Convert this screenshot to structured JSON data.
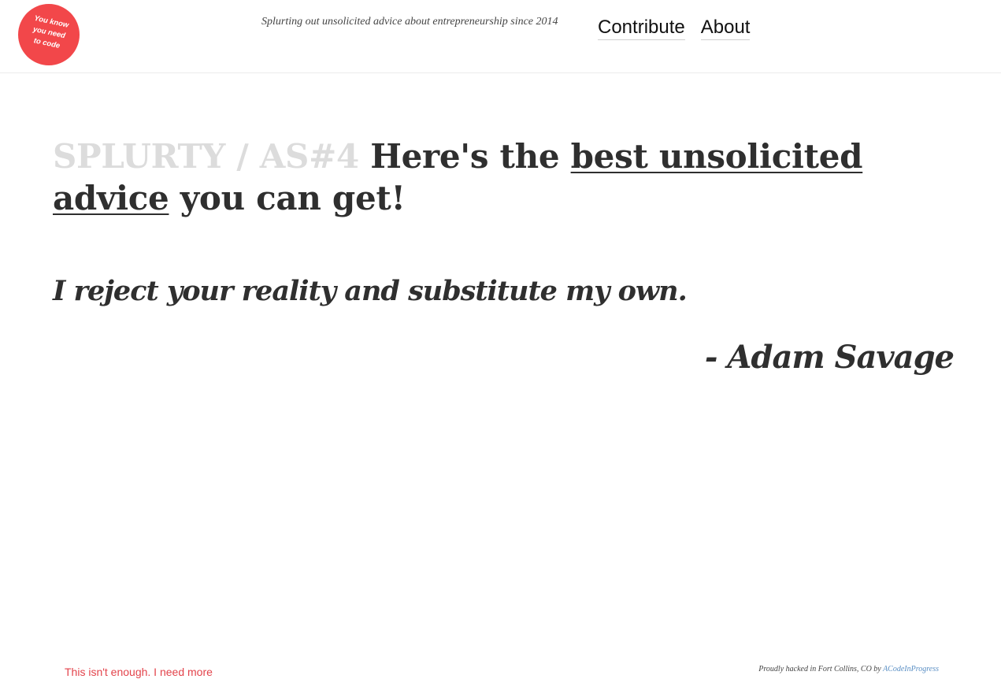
{
  "header": {
    "logo": {
      "lines": [
        "You know",
        "you need",
        "to code"
      ],
      "color": "#f2474a"
    },
    "tagline": "Splurting out unsolicited advice about entrepreneurship since 2014",
    "nav": {
      "contribute": "Contribute",
      "about": "About"
    }
  },
  "main": {
    "title": {
      "prefix": "SPLURTY / AS#4",
      "before_link": "Here's the",
      "link": "best unsolicited advice",
      "after_link": "you can get!"
    },
    "quote": "I reject your reality and substitute my own.",
    "author": "- Adam Savage"
  },
  "footer": {
    "more_link": "This isn't enough. I need more",
    "credit_prefix": "Proudly hacked in Fort Collins, CO by",
    "credit_link": "ACodeInProgress"
  },
  "colors": {
    "accent": "#f2474a",
    "prefix_gray": "#dcdcdc",
    "text": "#2f2f2f",
    "footer_link": "#e3434b",
    "credit_link": "#5a8fc4"
  }
}
